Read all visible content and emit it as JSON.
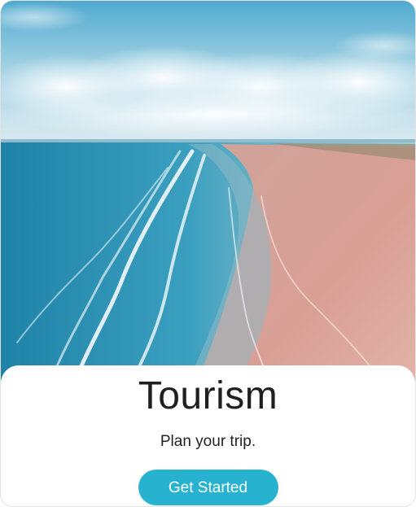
{
  "card": {
    "title": "Tourism",
    "subtitle": "Plan your trip.",
    "button_label": "Get Started"
  },
  "colors": {
    "accent": "#27b3cf",
    "title_text": "#1f1f1f",
    "sea": "#2a8fb0",
    "sand": "#d9a397",
    "sky": "#8fc6dc"
  }
}
